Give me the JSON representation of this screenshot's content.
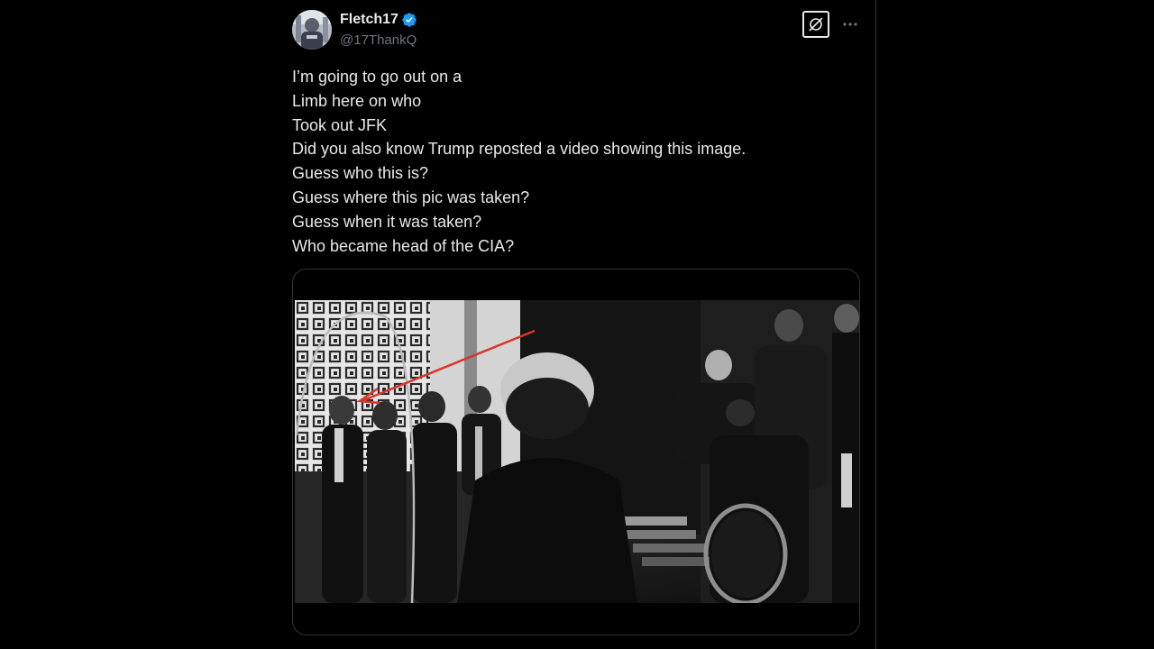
{
  "author": {
    "display_name": "Fletch17",
    "handle": "@17ThankQ",
    "verified": true,
    "avatar_icon": "avatar-image"
  },
  "actions": {
    "grok_icon": "grok-icon",
    "more_icon": "more-dots-icon"
  },
  "post": {
    "lines": [
      "I’m going to go out on a",
      "Limb here on who",
      "Took out JFK",
      "Did you also know Trump reposted a video showing this image.",
      "Guess who this is?",
      "Guess where this pic was taken?",
      "Guess when it was taken?",
      "Who became head of the CIA?"
    ]
  },
  "media": {
    "type": "black-and-white photo",
    "annotation": "red-arrow-and-circle"
  },
  "colors": {
    "background": "#000000",
    "text_primary": "#e7e9ea",
    "text_secondary": "#71767b",
    "verified_blue": "#1d9bf0",
    "border": "#2f3336",
    "annotation_red": "#d9352b"
  }
}
